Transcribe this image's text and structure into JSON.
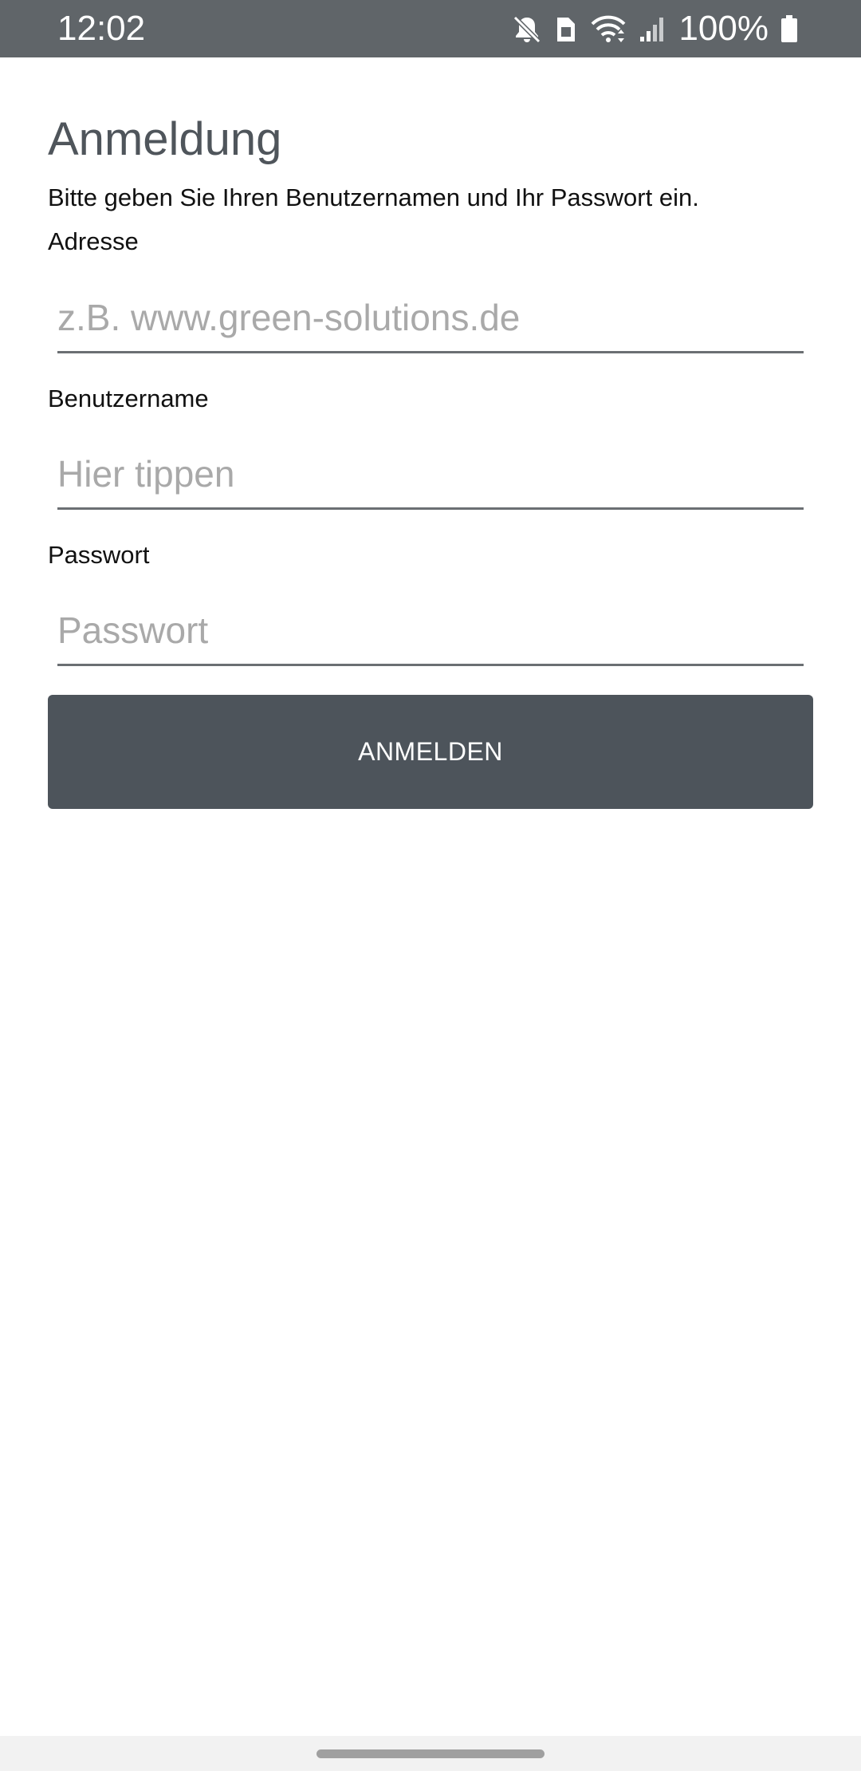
{
  "status_bar": {
    "time": "12:02",
    "battery_percent": "100%",
    "icons": [
      "mute-icon",
      "sim-icon",
      "wifi-icon",
      "signal-icon",
      "battery-icon"
    ],
    "background": "#606569"
  },
  "login": {
    "title": "Anmeldung",
    "instructions": "Bitte geben Sie Ihren Benutzernamen und Ihr Passwort ein.",
    "address": {
      "label": "Adresse",
      "placeholder": "z.B. www.green-solutions.de",
      "value": ""
    },
    "username": {
      "label": "Benutzername",
      "placeholder": "Hier tippen",
      "value": ""
    },
    "password": {
      "label": "Passwort",
      "placeholder": "Passwort",
      "value": ""
    },
    "submit_label": "ANMELDEN",
    "button_color": "#4d545b"
  }
}
